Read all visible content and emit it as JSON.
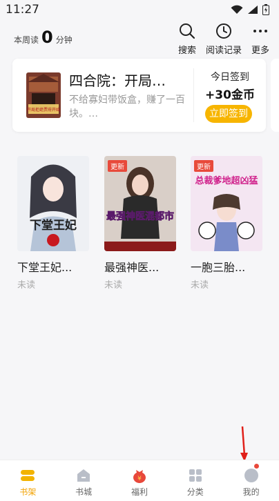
{
  "status_bar": {
    "time": "11:27"
  },
  "header": {
    "read_prefix": "本周读",
    "read_minutes": "0",
    "read_suffix": "分钟",
    "actions": [
      {
        "label": "搜索",
        "icon": "search-icon"
      },
      {
        "label": "阅读记录",
        "icon": "clock-icon"
      },
      {
        "label": "更多",
        "icon": "more-icon"
      }
    ]
  },
  "recommend": {
    "title": "四合院：开局…",
    "description": "不给寡妇带饭盒，赚了一百块。…",
    "cover_text": "开局拒绝贾府开始"
  },
  "sign_in": {
    "label": "今日签到",
    "reward": "+30金币",
    "button": "立即签到"
  },
  "shelf": {
    "books": [
      {
        "title": "下堂王妃...",
        "status": "未读",
        "cover_text": "下堂王妃",
        "badge": ""
      },
      {
        "title": "最强神医...",
        "status": "未读",
        "cover_text": "最强神医混都市",
        "badge": "更新"
      },
      {
        "title": "一胞三胎...",
        "status": "未读",
        "cover_text": "总裁爹地超凶猛",
        "badge": "更新"
      }
    ]
  },
  "tabs": [
    {
      "label": "书架",
      "icon": "bookshelf-icon",
      "active": true
    },
    {
      "label": "书城",
      "icon": "bookstore-icon",
      "active": false
    },
    {
      "label": "福利",
      "icon": "gift-icon",
      "active": false
    },
    {
      "label": "分类",
      "icon": "category-icon",
      "active": false
    },
    {
      "label": "我的",
      "icon": "profile-icon",
      "active": false
    }
  ],
  "colors": {
    "accent": "#f7b500",
    "active_tab": "#f2a200",
    "badge_red": "#e84a3b",
    "background": "#f6f6f8"
  }
}
